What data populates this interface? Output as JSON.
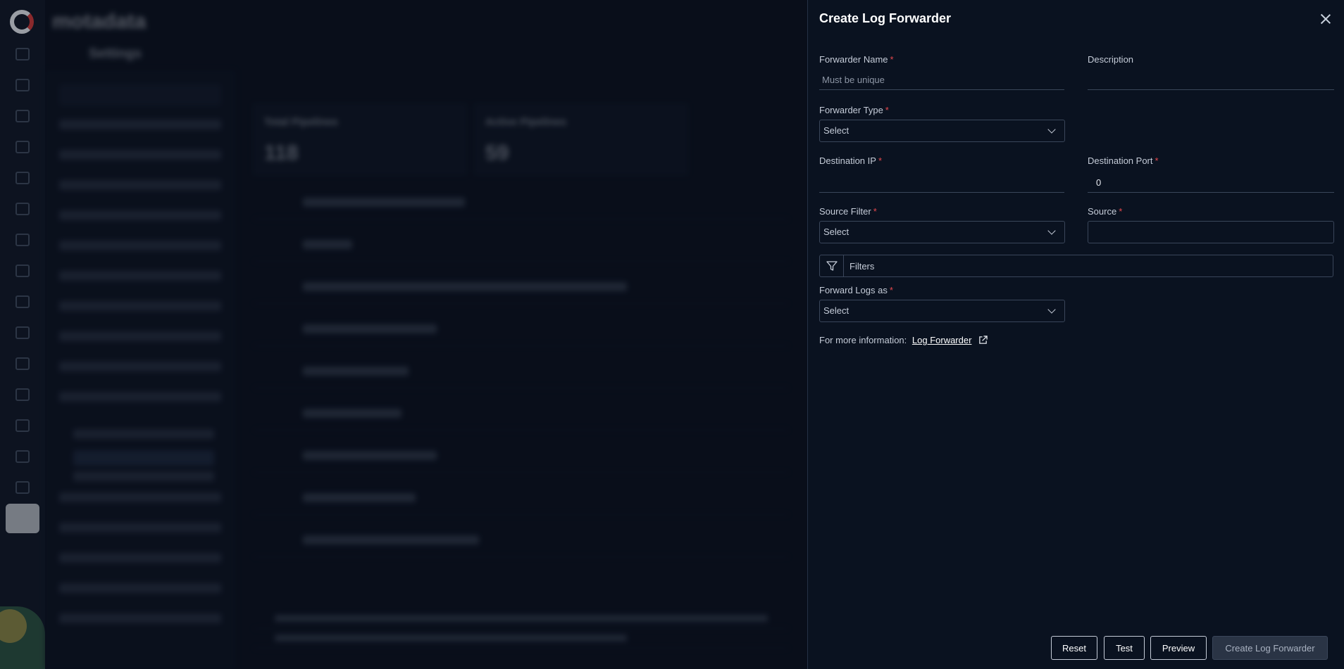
{
  "drawer": {
    "title": "Create Log Forwarder",
    "fields": {
      "forwarder_name": {
        "label": "Forwarder Name",
        "placeholder": "Must be unique",
        "value": ""
      },
      "description": {
        "label": "Description",
        "value": ""
      },
      "forwarder_type": {
        "label": "Forwarder Type",
        "value": "Select"
      },
      "destination_ip": {
        "label": "Destination IP",
        "value": ""
      },
      "destination_port": {
        "label": "Destination Port",
        "value": "0"
      },
      "source_filter": {
        "label": "Source Filter",
        "value": "Select"
      },
      "source": {
        "label": "Source",
        "value": ""
      },
      "filters": {
        "label": "Filters"
      },
      "forward_logs_as": {
        "label": "Forward Logs as",
        "value": "Select"
      }
    },
    "info": {
      "prefix": "For more information:",
      "link": "Log Forwarder"
    },
    "buttons": {
      "reset": "Reset",
      "test": "Test",
      "preview": "Preview",
      "create": "Create Log Forwarder"
    }
  },
  "background": {
    "brand": "motadata",
    "section": "Settings",
    "cards": [
      {
        "label": "Total Pipelines",
        "value": "118"
      },
      {
        "label": "Active Pipelines",
        "value": "59"
      }
    ]
  }
}
